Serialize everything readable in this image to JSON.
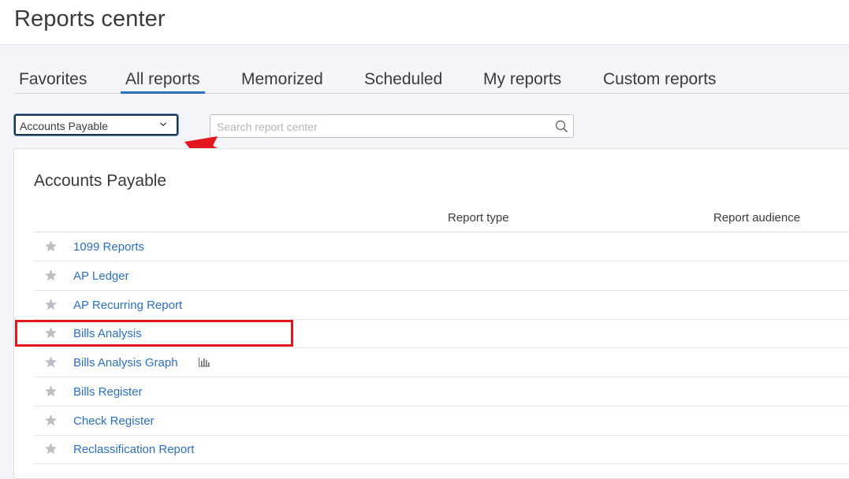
{
  "header": {
    "title": "Reports center"
  },
  "tabs": [
    {
      "label": "Favorites",
      "active": false
    },
    {
      "label": "All reports",
      "active": true
    },
    {
      "label": "Memorized",
      "active": false
    },
    {
      "label": "Scheduled",
      "active": false
    },
    {
      "label": "My reports",
      "active": false
    },
    {
      "label": "Custom reports",
      "active": false
    }
  ],
  "filter": {
    "selected": "Accounts Payable"
  },
  "search": {
    "placeholder": "Search report center",
    "value": ""
  },
  "section": {
    "title": "Accounts Payable",
    "columns": {
      "report_type": "Report type",
      "report_audience": "Report audience"
    }
  },
  "reports": [
    {
      "label": "1099 Reports",
      "icon": "star-icon",
      "favorite": false
    },
    {
      "label": "AP Ledger",
      "icon": "star-icon",
      "favorite": false
    },
    {
      "label": "AP Recurring Report",
      "icon": "star-icon",
      "favorite": false
    },
    {
      "label": "Bills Analysis",
      "icon": "star-icon",
      "favorite": false,
      "highlighted": true
    },
    {
      "label": "Bills Analysis Graph",
      "icon": "star-icon",
      "favorite": false,
      "extra_icon": "bar-chart-icon"
    },
    {
      "label": "Bills Register",
      "icon": "star-icon",
      "favorite": false
    },
    {
      "label": "Check Register",
      "icon": "star-icon",
      "favorite": false
    },
    {
      "label": "Reclassification Report",
      "icon": "star-icon",
      "favorite": false
    }
  ],
  "colors": {
    "link": "#2c6fbe",
    "active_tab_underline": "#2c6fbe",
    "annotation_red": "#e3161e",
    "star": "#babec5"
  }
}
